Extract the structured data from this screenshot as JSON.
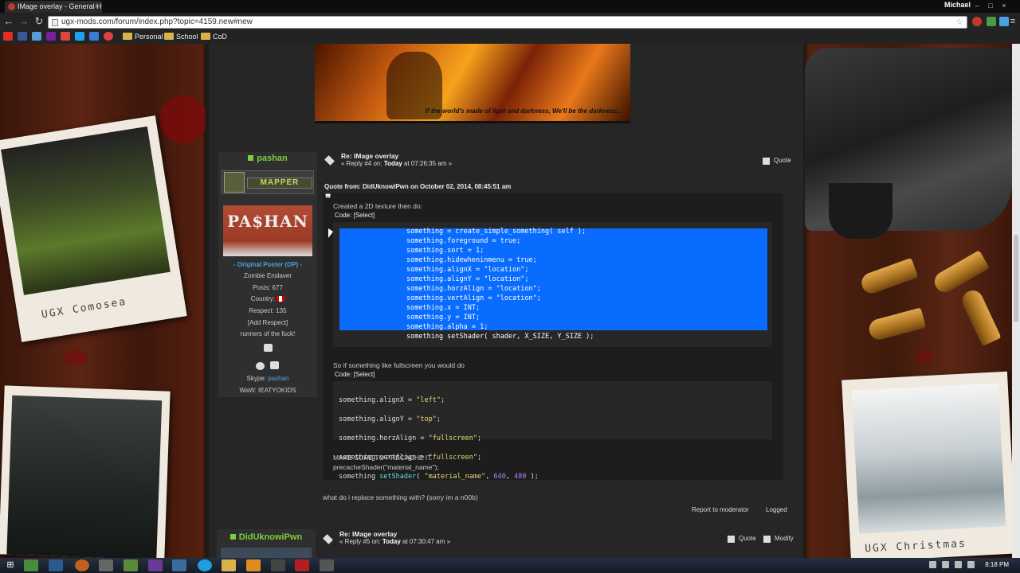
{
  "browser": {
    "tab_title": "IMage overlay - General H",
    "user_name": "Michael",
    "url": "ugx-mods.com/forum/index.php?topic=4159.new#new",
    "bookmarks": [
      "Personal",
      "School",
      "CoD"
    ]
  },
  "banner": {
    "caption": "If the world's made of light and darkness, We'll be the darkness..."
  },
  "decor": {
    "left_polaroid_caption": "UGX Comosea",
    "right_polaroid_caption": "UGX Christmas"
  },
  "post": {
    "username": "pashan",
    "rank": "MAPPER",
    "avatar_text": "PA$HAN",
    "op_label": "- Original Poster (OP) -",
    "title_text": "Zombie Enslaver",
    "posts": "Posts: 677",
    "country_label": "Country:",
    "respect": "Respect: 135",
    "add_respect": "[Add Respect]",
    "personal_text": "runners of the fuck!",
    "skype_label": "Skype:",
    "skype_name": "pashan",
    "waw": "WaW: IEATYOKIDS",
    "subject": "Re: IMage overlay",
    "meta_prefix": "« Reply #4 on:",
    "meta_today": "Today",
    "meta_suffix": "at 07:26:35 am »",
    "quote_button": "Quote",
    "quote_header": "Quote from: DidUknowiPwn on October 02, 2014, 08:45:51 am",
    "quote_line1": "Created a 2D texture then do:",
    "code_label": "Code:",
    "code_select": "[Select]",
    "code1": [
      "something = create_simple_something( self );",
      "something.foreground = true;",
      "something.sort = 1;",
      "something.hidewheninmenu = true;",
      "something.alignX = \"location\";",
      "something.alignY = \"location\";",
      "something.horzAlign = \"location\";",
      "something.vertAlign = \"location\";",
      "something.x = INT;",
      "something.y = INT;",
      "something.alpha = 1;",
      "something setShader( shader, X_SIZE, Y_SIZE );"
    ],
    "quote_line2": "So if something like fullscreen you would do",
    "code2": {
      "l1a": "something.alignX = ",
      "l1b": "\"left\"",
      "l1c": ";",
      "l2a": "something.alignY = ",
      "l2b": "\"top\"",
      "l2c": ";",
      "l3a": "something.horzAlign = ",
      "l3b": "\"fullscreen\"",
      "l3c": ";",
      "l4a": "something.vertAlign = ",
      "l4b": "\"fullscreen\"",
      "l4c": ";",
      "l5a": "something ",
      "l5b": "setShader",
      "l5c": "( ",
      "l5d": "\"material_name\"",
      "l5e": ", ",
      "l5f": "640",
      "l5g": ", ",
      "l5h": "480",
      "l5i": " );"
    },
    "quote_line3": "MAKE SURE TO PRECACHE IT.",
    "quote_line4": "precacheShader(\"material_name\");",
    "reply_text": "what do i replace something with? (sorry im a n00b)",
    "report": "Report to moderator",
    "logged": "Logged"
  },
  "next_post": {
    "username": "DidUknowiPwn",
    "subject": "Re: IMage overlay",
    "meta_prefix": "« Reply #5 on:",
    "meta_today": "Today",
    "meta_suffix": "at 07:30:47 am »",
    "quote_button": "Quote",
    "modify_button": "Modify"
  },
  "taskbar": {
    "clock": "8:18 PM"
  },
  "colors": {
    "accent_green": "#7ccf3c",
    "link_blue": "#4aa3e0",
    "selection": "#0a6cff"
  }
}
